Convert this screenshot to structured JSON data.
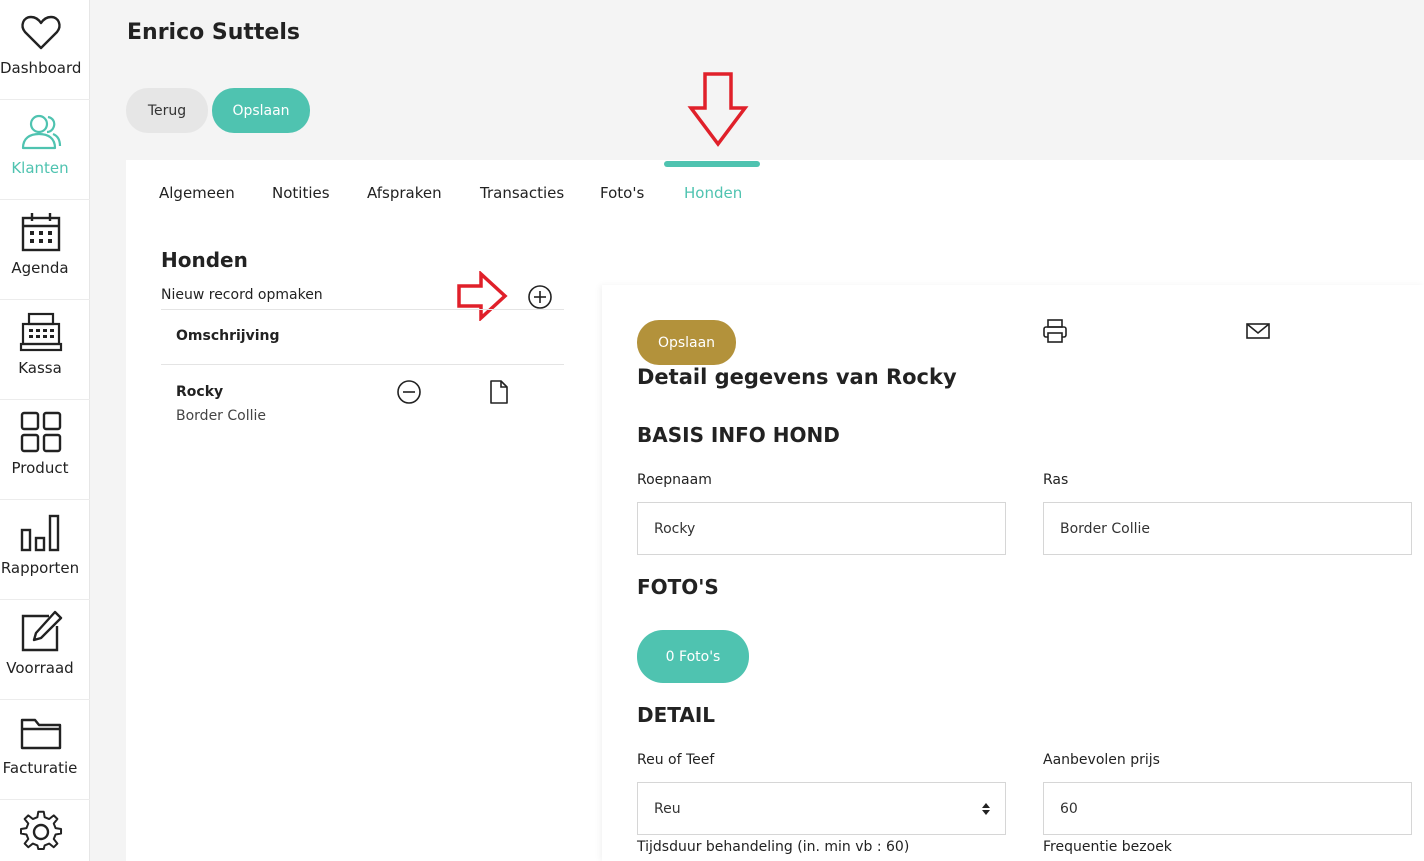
{
  "sidebar": {
    "items": [
      {
        "label": "Dashboard",
        "icon": "heart-icon"
      },
      {
        "label": "Klanten",
        "icon": "users-icon",
        "active": true
      },
      {
        "label": "Agenda",
        "icon": "calendar-icon"
      },
      {
        "label": "Kassa",
        "icon": "cash-register-icon"
      },
      {
        "label": "Product",
        "icon": "grid-icon"
      },
      {
        "label": "Rapporten",
        "icon": "bar-chart-icon"
      },
      {
        "label": "Voorraad",
        "icon": "edit-icon"
      },
      {
        "label": "Facturatie",
        "icon": "folder-icon"
      },
      {
        "label": "",
        "icon": "gear-icon"
      }
    ]
  },
  "header": {
    "title": "Enrico Suttels",
    "back_label": "Terug",
    "save_label": "Opslaan"
  },
  "tabs": [
    {
      "label": "Algemeen"
    },
    {
      "label": "Notities"
    },
    {
      "label": "Afspraken"
    },
    {
      "label": "Transacties"
    },
    {
      "label": "Foto's"
    },
    {
      "label": "Honden",
      "active": true
    }
  ],
  "list": {
    "title": "Honden",
    "new_record_label": "Nieuw record opmaken",
    "column_header": "Omschrijving",
    "rows": [
      {
        "name": "Rocky",
        "breed": "Border Collie"
      }
    ]
  },
  "detail": {
    "save_label": "Opslaan",
    "title": "Detail gegevens van Rocky",
    "basis_title": "BASIS INFO HOND",
    "roepnaam_label": "Roepnaam",
    "roepnaam_value": "Rocky",
    "ras_label": "Ras",
    "ras_value": "Border Collie",
    "fotos_title": "FOTO'S",
    "fotos_button": "0 Foto's",
    "detail_title": "DETAIL",
    "reu_label": "Reu of Teef",
    "reu_value": "Reu",
    "prijs_label": "Aanbevolen prijs",
    "prijs_value": "60",
    "tijdsduur_label": "Tijdsduur behandeling (in. min vb : 60)",
    "frequentie_label": "Frequentie bezoek"
  },
  "colors": {
    "accent": "#4fc3b0",
    "gold": "#b3923b",
    "annotation": "#e0202a"
  }
}
